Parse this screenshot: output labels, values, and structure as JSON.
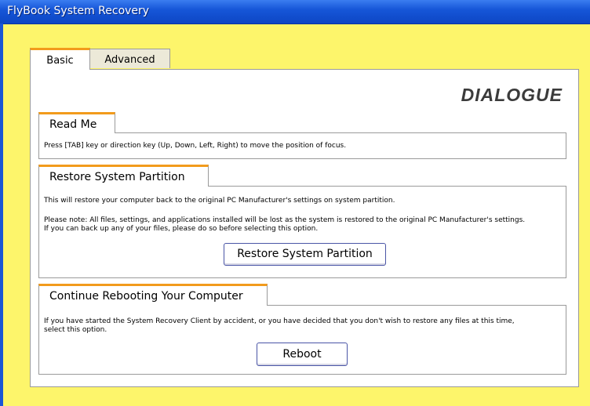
{
  "window": {
    "title": "FlyBook System Recovery"
  },
  "tabs": [
    {
      "label": "Basic",
      "active": true
    },
    {
      "label": "Advanced",
      "active": false
    }
  ],
  "logo_text": "DIALOGUE",
  "sections": {
    "readme": {
      "title": "Read Me",
      "text": "Press [TAB] key or direction key (Up, Down, Left, Right) to move the position of focus."
    },
    "restore": {
      "title": "Restore System Partition",
      "text1": "This will restore your computer back to the original PC Manufacturer's settings on system partition.",
      "text2": "Please note: All files, settings, and applications installed will be lost as the system is restored to the original PC Manufacturer's settings.",
      "text3": "If you can back up any of your files, please do so before selecting this option.",
      "button_label": "Restore System Partition"
    },
    "reboot": {
      "title": "Continue Rebooting Your Computer",
      "text1": "If you have started the System Recovery Client by accident, or you have decided that you don't wish to restore any files at this time,",
      "text2": "select this option.",
      "button_label": "Reboot"
    }
  },
  "colors": {
    "background": "#fdf56b",
    "titlebar": "#1656d8",
    "accent": "#f29b1c"
  }
}
